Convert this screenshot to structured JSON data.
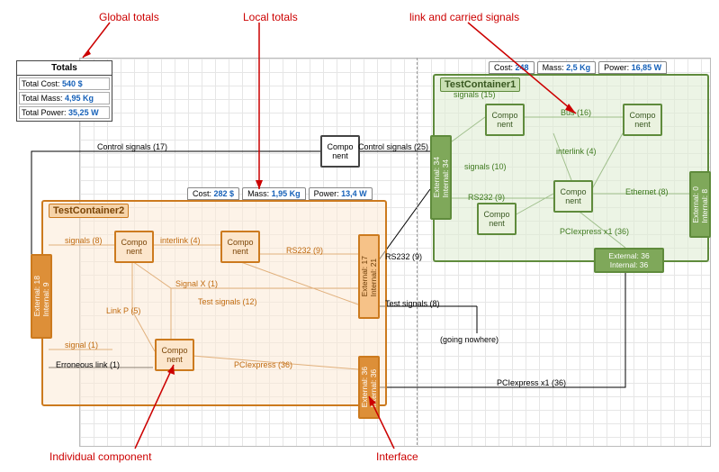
{
  "callouts": {
    "global_totals": "Global totals",
    "local_totals": "Local totals",
    "link_signals": "link and carried signals",
    "individual_component": "Individual component",
    "interface": "Interface"
  },
  "totals": {
    "header": "Totals",
    "cost_lbl": "Total Cost:",
    "cost_val": "540 $",
    "mass_lbl": "Total Mass:",
    "mass_val": "4,95 Kg",
    "power_lbl": "Total Power:",
    "power_val": "35,25 W"
  },
  "test_container_1": {
    "title": "TestContainer1",
    "tabs": {
      "cost_k": "Cost:",
      "cost_v": "248",
      "mass_k": "Mass:",
      "mass_v": "2,5 Kg",
      "power_k": "Power:",
      "power_v": "16,85 W"
    },
    "signals_15": "signals (15)",
    "bus_16": "Bus (16)",
    "signals_10": "signals (10)",
    "interlink_4": "interlink (4)",
    "rs232_9": "RS232 (9)",
    "ethernet_8": "Ethernet (8)",
    "pciexpress_36": "PCIexpress x1 (36)",
    "iface_left": "External: 34\nInternal: 34",
    "iface_right": "External: 0\nInternal: 8",
    "iface_bottom": "External: 36\nInternal: 36"
  },
  "test_container_2": {
    "title": "TestContainer2",
    "tabs": {
      "cost_k": "Cost:",
      "cost_v": "282 $",
      "mass_k": "Mass:",
      "mass_v": "1,95 Kg",
      "power_k": "Power:",
      "power_v": "13,4 W"
    },
    "signals_8": "signals (8)",
    "interlink_4": "interlink (4)",
    "rs232_9": "RS232 (9)",
    "signal_x_1": "Signal X (1)",
    "test_signals_12": "Test signals (12)",
    "link_p_5": "Link P (5)",
    "signal_1": "signal (1)",
    "erroneous_link_1": "Erroneous link (1)",
    "pciexpress_36": "PCIexpress (36)",
    "iface_left": "External: 18\nInternal: 9",
    "iface_r1": "External: 17\nInternal: 21",
    "iface_r2": "External: 36\nInternal: 36"
  },
  "free_comp": "Compo\nnent",
  "middle_links": {
    "control_17": "Control signals (17)",
    "control_25": "Control signals (25)",
    "rs232_9": "RS232 (9)",
    "test_8": "Test signals (8)",
    "going_nowhere": "(going nowhere)",
    "pciexpress_36": "PCIexpress x1 (36)"
  },
  "comp_label": "Compo\nnent"
}
